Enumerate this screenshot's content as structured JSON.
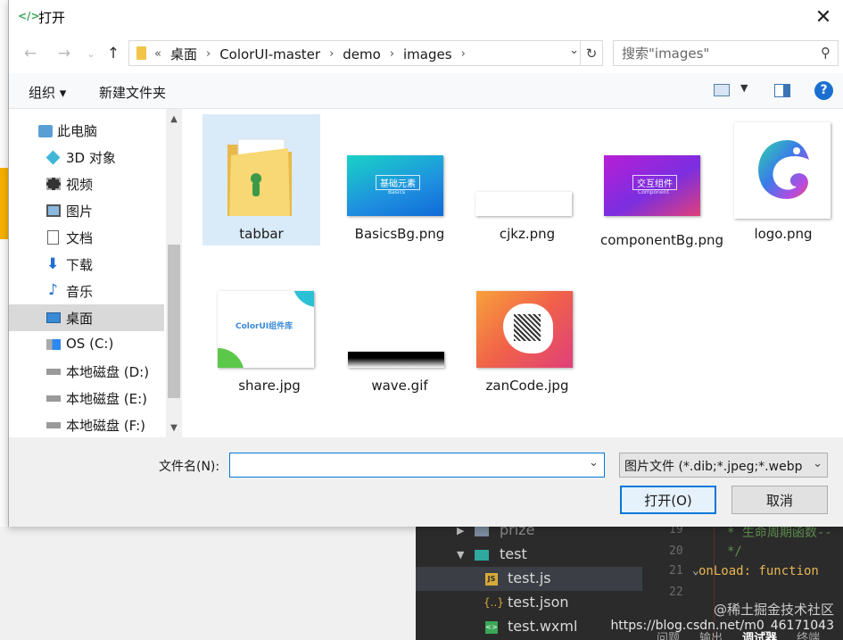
{
  "dialog": {
    "title": "打开",
    "address_crumbs": [
      "«",
      "桌面",
      "ColorUI-master",
      "demo",
      "images"
    ],
    "search_placeholder": "搜索\"images\"",
    "toolbar": {
      "organize": "组织 ▾",
      "new_folder": "新建文件夹"
    },
    "nav_items": [
      {
        "label": "此电脑",
        "icon": "computer-icon"
      },
      {
        "label": "3D 对象",
        "icon": "3d-objects-icon"
      },
      {
        "label": "视频",
        "icon": "video-icon"
      },
      {
        "label": "图片",
        "icon": "pictures-icon"
      },
      {
        "label": "文档",
        "icon": "documents-icon"
      },
      {
        "label": "下载",
        "icon": "download-icon"
      },
      {
        "label": "音乐",
        "icon": "music-icon"
      },
      {
        "label": "桌面",
        "icon": "desktop-icon"
      },
      {
        "label": "OS (C:)",
        "icon": "os-drive-icon"
      },
      {
        "label": "本地磁盘 (D:)",
        "icon": "drive-icon"
      },
      {
        "label": "本地磁盘 (E:)",
        "icon": "drive-icon"
      },
      {
        "label": "本地磁盘 (F:)",
        "icon": "drive-icon"
      }
    ],
    "files": [
      {
        "name": "tabbar",
        "type": "folder"
      },
      {
        "name": "BasicsBg.png",
        "type": "image",
        "thumb_text": "基础元素",
        "thumb_sub": "Basics"
      },
      {
        "name": "cjkz.png",
        "type": "image"
      },
      {
        "name": "componentBg.png",
        "type": "image",
        "thumb_text": "交互组件",
        "thumb_sub": "Component"
      },
      {
        "name": "logo.png",
        "type": "image"
      },
      {
        "name": "share.jpg",
        "type": "image",
        "thumb_text": "ColorUI组件库"
      },
      {
        "name": "wave.gif",
        "type": "image"
      },
      {
        "name": "zanCode.jpg",
        "type": "image"
      }
    ],
    "filename_label": "文件名(N):",
    "filename_value": "",
    "filetype_value": "图片文件 (*.dib;*.jpeg;*.webp",
    "open_button": "打开(O)",
    "cancel_button": "取消",
    "colors": {
      "accent": "#0078d7",
      "selection": "#d9ebf9",
      "help": "#1a6fd1"
    }
  },
  "background": {
    "tree": [
      {
        "label": "prize",
        "icon": "folder-icon"
      },
      {
        "label": "test",
        "icon": "folder-icon"
      },
      {
        "label": "test.js",
        "icon": "js-file-icon"
      },
      {
        "label": "test.json",
        "icon": "json-file-icon"
      },
      {
        "label": "test.wxml",
        "icon": "wxml-file-icon"
      }
    ],
    "line_numbers": [
      "19",
      "20",
      "21",
      "22"
    ],
    "code_lines": [
      "* 生命周期函数--",
      "*/",
      "onLoad: function",
      ""
    ],
    "bottom_tabs": [
      "问题",
      "输出",
      "调试器",
      "终端"
    ],
    "watermark_top": "@稀土掘金技术社区",
    "watermark_bottom": "https://blog.csdn.net/m0_46171043"
  }
}
